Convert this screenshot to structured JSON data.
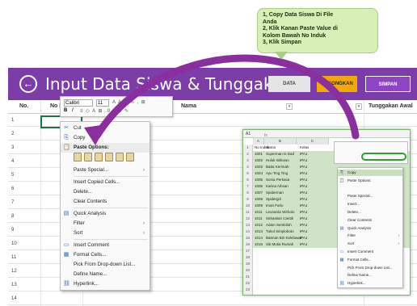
{
  "callout": {
    "lines": [
      "1, Copy Data Siswa Di File",
      "Anda",
      "2, Klik Kanan Paste Value di",
      "Kolom Bawah No Induk",
      "3, Klik Simpan"
    ]
  },
  "header": {
    "title": "Input Data Siswa & Tunggakan !",
    "back_icon": "←",
    "btn_data": "DATA",
    "btn_kosongkan": "KOSONGKAN",
    "btn_simpan": "SIMPAN"
  },
  "colors": {
    "header_bg": "#7d3da8",
    "kosongkan_bg": "#f2a900",
    "arrow": "#8a2f9e",
    "callout_bg": "#d6f0b8"
  },
  "grid": {
    "columns": [
      "No.",
      "No Induk",
      "Nama",
      "Tunggakan Awal"
    ],
    "rows": [
      "1",
      "2",
      "3",
      "4",
      "5",
      "6",
      "7",
      "8",
      "9",
      "10",
      "11",
      "12",
      "13",
      "14"
    ]
  },
  "minitoolbar": {
    "font": "Calibri",
    "size": "11",
    "bold": "B",
    "italic": "I",
    "icons_top": "A A $ % , ⊞",
    "icons_bottom": "≡ ◇ A ⊞ .0 .00 ✎"
  },
  "context_menu": {
    "items": [
      {
        "icon": "✂",
        "label": "Cut",
        "arrow": ""
      },
      {
        "icon": "⎘",
        "label": "Copy",
        "arrow": ""
      },
      {
        "icon": "📋",
        "label": "Paste Options:",
        "arrow": ""
      },
      {
        "icon": "",
        "label": "",
        "arrow": ""
      },
      {
        "icon": "",
        "label": "Paste Special...",
        "arrow": "›"
      },
      {
        "icon": "",
        "label": "Insert Copied Cells...",
        "arrow": ""
      },
      {
        "icon": "",
        "label": "Delete...",
        "arrow": ""
      },
      {
        "icon": "",
        "label": "Clear Contents",
        "arrow": ""
      },
      {
        "icon": "▤",
        "label": "Quick Analysis",
        "arrow": ""
      },
      {
        "icon": "",
        "label": "Filter",
        "arrow": "›"
      },
      {
        "icon": "",
        "label": "Sort",
        "arrow": "›"
      },
      {
        "icon": "▭",
        "label": "Insert Comment",
        "arrow": ""
      },
      {
        "icon": "▦",
        "label": "Format Cells...",
        "arrow": ""
      },
      {
        "icon": "",
        "label": "Pick From Drop-down List...",
        "arrow": ""
      },
      {
        "icon": "",
        "label": "Define Name...",
        "arrow": ""
      },
      {
        "icon": "⛓",
        "label": "Hyperlink...",
        "arrow": ""
      }
    ]
  },
  "inset": {
    "namebox": "A1",
    "fx": "fx",
    "col_heads": [
      "A",
      "B",
      "C"
    ],
    "headers": [
      "No Induk",
      "Nama",
      "Kelas"
    ],
    "rows": [
      {
        "n": "1",
        "id": "No Induk",
        "name": "Nama",
        "kelas": "Kelas"
      },
      {
        "n": "2",
        "id": "1001",
        "name": "Superman Is Dad",
        "kelas": "IPA1"
      },
      {
        "n": "3",
        "id": "1002",
        "name": "Hulok Wibowo",
        "kelas": "IPA1"
      },
      {
        "n": "4",
        "id": "1003",
        "name": "Batta Kerimah",
        "kelas": "IPA1"
      },
      {
        "n": "5",
        "id": "1004",
        "name": "Ayu Ting Ting",
        "kelas": "IPA1"
      },
      {
        "n": "6",
        "id": "1005",
        "name": "Sonia Perkasa",
        "kelas": "IPA1"
      },
      {
        "n": "7",
        "id": "1006",
        "name": "Karina Aihsan",
        "kelas": "IPA1"
      },
      {
        "n": "8",
        "id": "1007",
        "name": "Spiderman",
        "kelas": "IPA1"
      },
      {
        "n": "9",
        "id": "1008",
        "name": "Spidergirl",
        "kelas": "IPA1"
      },
      {
        "n": "10",
        "id": "1009",
        "name": "Iman Farlo",
        "kelas": "IPA1"
      },
      {
        "n": "11",
        "id": "1011",
        "name": "Leonardo Wirbolo",
        "kelas": "IPA1"
      },
      {
        "n": "12",
        "id": "1011",
        "name": "Sebastian Cantik",
        "kelas": "IPA1"
      },
      {
        "n": "13",
        "id": "1012",
        "name": "Adam Sembiloh",
        "kelas": "IPA1"
      },
      {
        "n": "14",
        "id": "1013",
        "name": "Tukul Simploboto",
        "kelas": "IPA1"
      },
      {
        "n": "15",
        "id": "1014",
        "name": "Batman Bin Kelelawar",
        "kelas": "IPA1"
      },
      {
        "n": "16",
        "id": "1015",
        "name": "Siti Mutia Rumah",
        "kelas": "IPA1"
      },
      {
        "n": "17",
        "id": "",
        "name": "",
        "kelas": ""
      },
      {
        "n": "18",
        "id": "",
        "name": "",
        "kelas": ""
      },
      {
        "n": "19",
        "id": "",
        "name": "",
        "kelas": ""
      },
      {
        "n": "20",
        "id": "",
        "name": "",
        "kelas": ""
      },
      {
        "n": "21",
        "id": "",
        "name": "",
        "kelas": ""
      },
      {
        "n": "22",
        "id": "",
        "name": "",
        "kelas": ""
      },
      {
        "n": "23",
        "id": "",
        "name": "",
        "kelas": ""
      },
      {
        "n": "24",
        "id": "",
        "name": "",
        "kelas": ""
      }
    ],
    "menu": [
      {
        "icon": "⎘",
        "label": "Copy",
        "hl": true,
        "arrow": ""
      },
      {
        "icon": "📋",
        "label": "Paste Options:",
        "hl": false,
        "arrow": ""
      },
      {
        "icon": "",
        "label": "",
        "hl": false,
        "arrow": ""
      },
      {
        "icon": "",
        "label": "Paste Special...",
        "hl": false,
        "arrow": ""
      },
      {
        "icon": "",
        "label": "Insert...",
        "hl": false,
        "arrow": ""
      },
      {
        "icon": "",
        "label": "Delete...",
        "hl": false,
        "arrow": ""
      },
      {
        "icon": "",
        "label": "Clear Contents",
        "hl": false,
        "arrow": ""
      },
      {
        "icon": "▤",
        "label": "Quick Analysis",
        "hl": false,
        "arrow": ""
      },
      {
        "icon": "",
        "label": "Filter",
        "hl": false,
        "arrow": "›"
      },
      {
        "icon": "",
        "label": "Sort",
        "hl": false,
        "arrow": "›"
      },
      {
        "icon": "▭",
        "label": "Insert Comment",
        "hl": false,
        "arrow": ""
      },
      {
        "icon": "▦",
        "label": "Format Cells...",
        "hl": false,
        "arrow": ""
      },
      {
        "icon": "",
        "label": "Pick From Drop-down List...",
        "hl": false,
        "arrow": ""
      },
      {
        "icon": "",
        "label": "Define Name...",
        "hl": false,
        "arrow": ""
      },
      {
        "icon": "⛓",
        "label": "Hyperlink...",
        "hl": false,
        "arrow": ""
      }
    ]
  }
}
